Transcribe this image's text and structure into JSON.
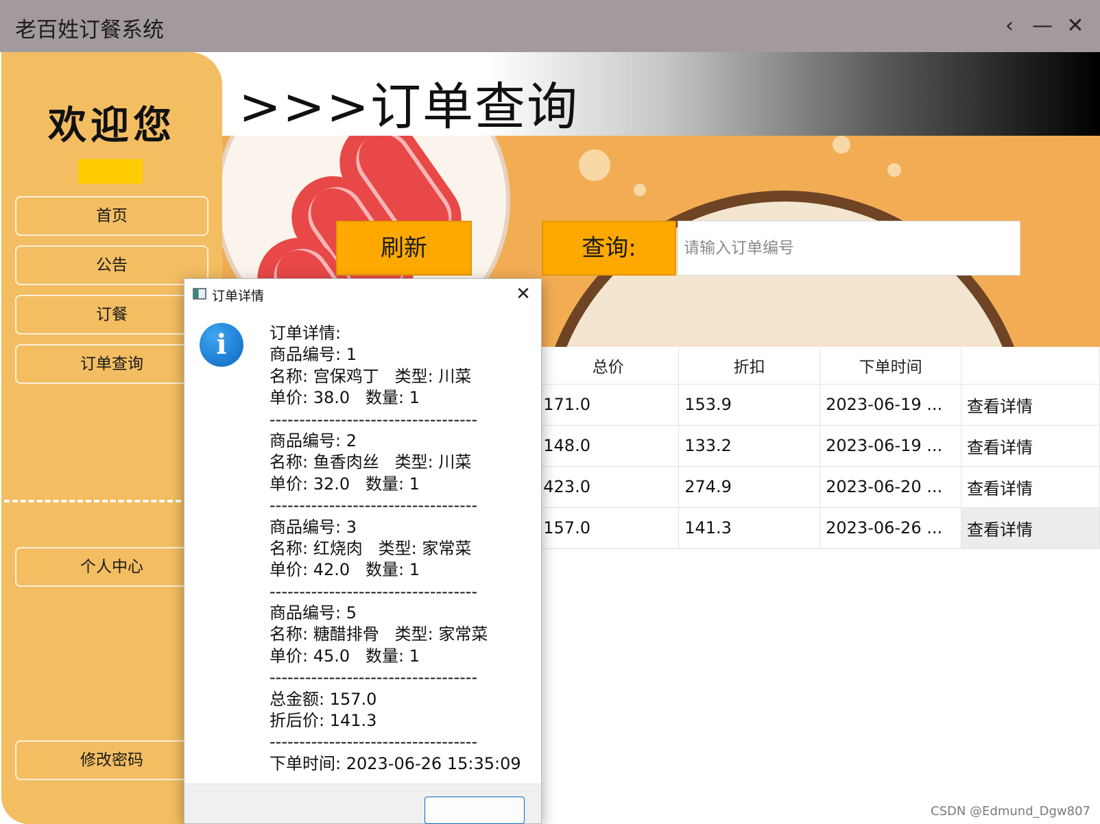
{
  "window": {
    "title": "老百姓订餐系统",
    "controls": {
      "back": "‹",
      "minimize": "—",
      "close": "✕"
    }
  },
  "sidebar": {
    "welcome": "欢迎您",
    "items": [
      {
        "label": "首页"
      },
      {
        "label": "公告"
      },
      {
        "label": "订餐"
      },
      {
        "label": "订单查询"
      },
      {
        "label": "个人中心"
      },
      {
        "label": "修改密码"
      }
    ],
    "accent_color": "#f3bd62",
    "badge_color": "#ffcc00"
  },
  "header": {
    "title": ">>>订单查询"
  },
  "toolbar": {
    "refresh_label": "刷新",
    "query_label": "查询:",
    "search_placeholder": "请输入订单编号",
    "button_color": "#ffa900"
  },
  "table": {
    "headers": [
      "",
      "总价",
      "折扣",
      "下单时间",
      ""
    ],
    "rows": [
      {
        "total": "171.0",
        "discount": "153.9",
        "time": "2023-06-19 ...",
        "action": "查看详情"
      },
      {
        "total": "148.0",
        "discount": "133.2",
        "time": "2023-06-19 ...",
        "action": "查看详情"
      },
      {
        "total": "423.0",
        "discount": "274.9",
        "time": "2023-06-20 ...",
        "action": "查看详情"
      },
      {
        "total": "157.0",
        "discount": "141.3",
        "time": "2023-06-26 ...",
        "action": "查看详情"
      }
    ]
  },
  "dialog": {
    "title": "订单详情",
    "close": "✕",
    "icon": "info-icon",
    "lines": [
      "订单详情:",
      "商品编号: 1",
      "名称: 宫保鸡丁   类型: 川菜",
      "单价: 38.0   数量: 1",
      "-----------------------------------",
      "商品编号: 2",
      "名称: 鱼香肉丝   类型: 川菜",
      "单价: 32.0   数量: 1",
      "-----------------------------------",
      "商品编号: 3",
      "名称: 红烧肉   类型: 家常菜",
      "单价: 42.0   数量: 1",
      "-----------------------------------",
      "商品编号: 5",
      "名称: 糖醋排骨   类型: 家常菜",
      "单价: 45.0   数量: 1",
      "-----------------------------------",
      "总金额: 157.0",
      "折后价: 141.3",
      "-----------------------------------",
      "下单时间: 2023-06-26 15:35:09"
    ]
  },
  "watermark": "CSDN @Edmund_Dgw807"
}
